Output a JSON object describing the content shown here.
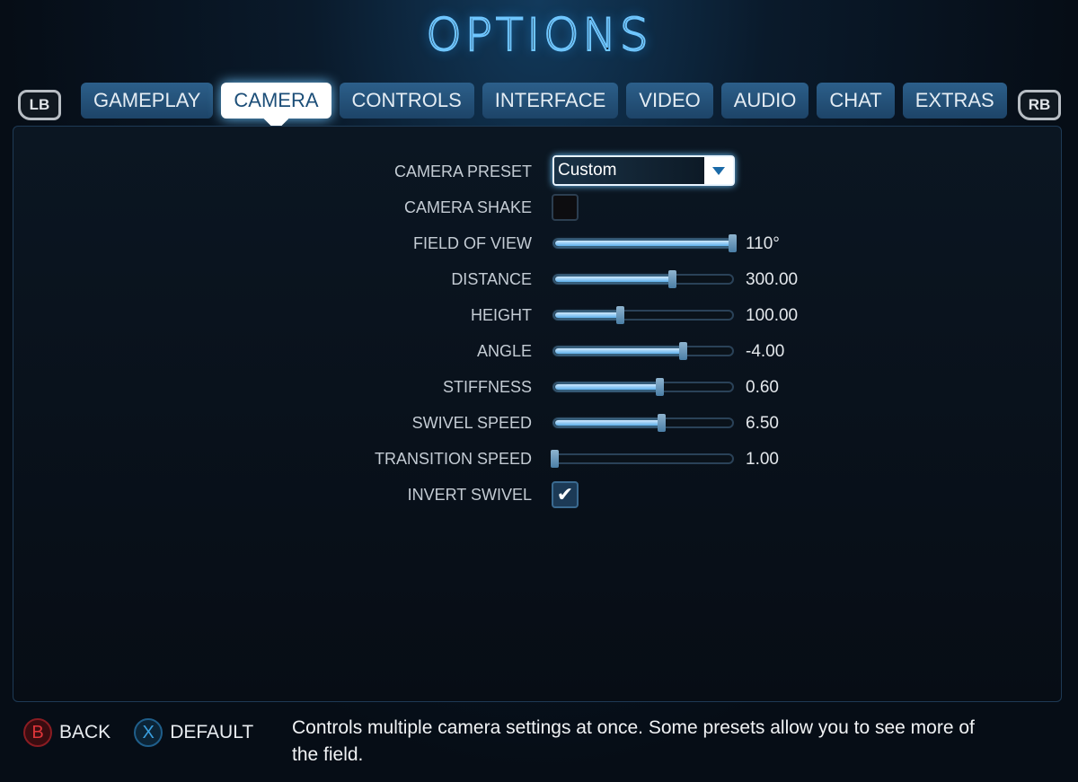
{
  "title": "OPTIONS",
  "bumpers": {
    "left": "LB",
    "right": "RB"
  },
  "tabs": [
    {
      "label": "GAMEPLAY"
    },
    {
      "label": "CAMERA",
      "active": true
    },
    {
      "label": "CONTROLS"
    },
    {
      "label": "INTERFACE"
    },
    {
      "label": "VIDEO"
    },
    {
      "label": "AUDIO"
    },
    {
      "label": "CHAT"
    },
    {
      "label": "EXTRAS"
    }
  ],
  "settings": {
    "camera_preset": {
      "label": "CAMERA PRESET",
      "value": "Custom"
    },
    "camera_shake": {
      "label": "CAMERA SHAKE",
      "checked": false
    },
    "sliders": [
      {
        "label": "FIELD OF VIEW",
        "value": "110°",
        "fraction": 1.0
      },
      {
        "label": "DISTANCE",
        "value": "300.00",
        "fraction": 0.66
      },
      {
        "label": "HEIGHT",
        "value": "100.00",
        "fraction": 0.37
      },
      {
        "label": "ANGLE",
        "value": "-4.00",
        "fraction": 0.72
      },
      {
        "label": "STIFFNESS",
        "value": "0.60",
        "fraction": 0.59
      },
      {
        "label": "SWIVEL SPEED",
        "value": "6.50",
        "fraction": 0.6
      },
      {
        "label": "TRANSITION SPEED",
        "value": "1.00",
        "fraction": 0.0
      }
    ],
    "invert_swivel": {
      "label": "INVERT SWIVEL",
      "checked": true,
      "check": "✔"
    }
  },
  "footer": {
    "back_icon": "B",
    "back": "BACK",
    "default_icon": "X",
    "default": "DEFAULT",
    "description": "Controls multiple camera settings at once. Some presets allow you to see more of the field."
  },
  "colors": {
    "accent": "#6fc6ff",
    "tab": "#1d4468",
    "back": "#e0353a",
    "default": "#3aa0e0"
  }
}
